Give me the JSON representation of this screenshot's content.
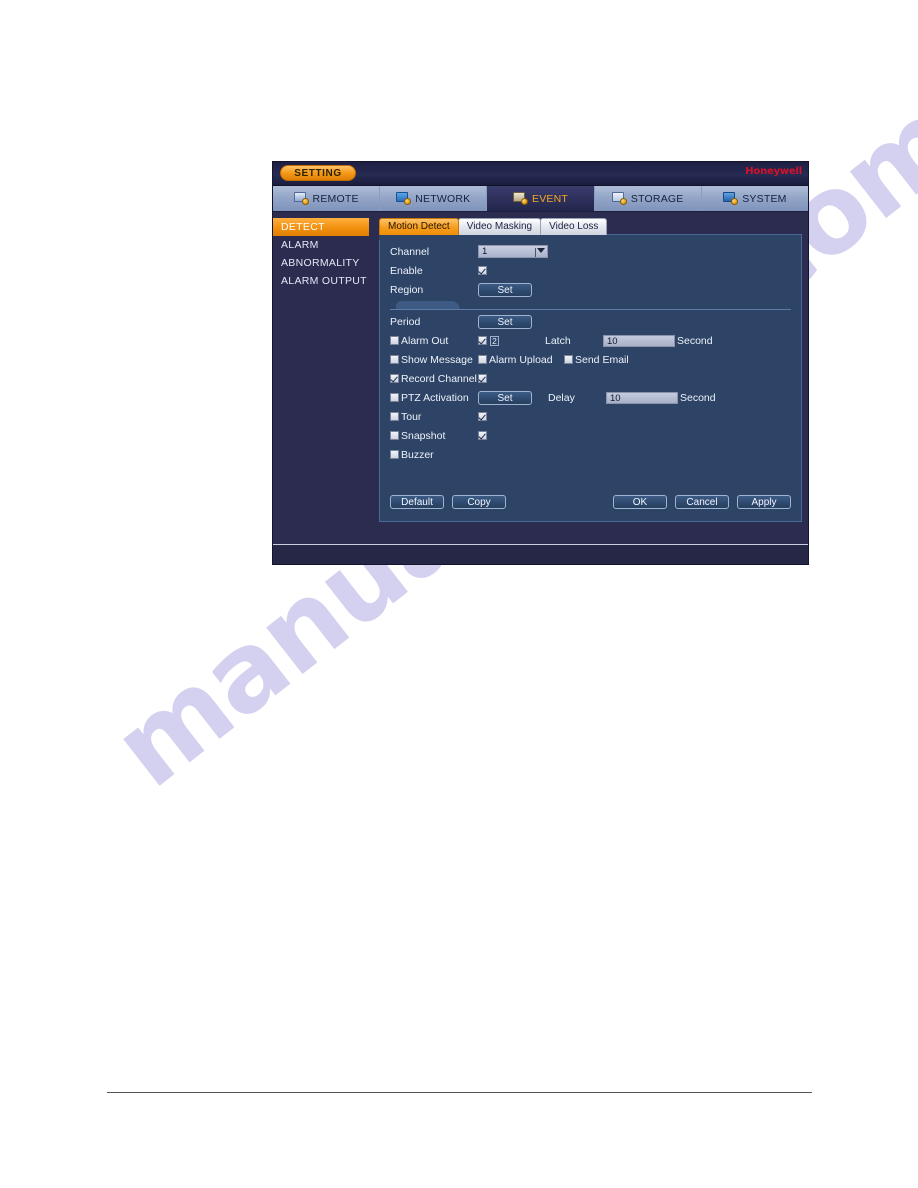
{
  "page": {
    "watermark": "manualshive.com"
  },
  "window": {
    "titlebar": {
      "setting_badge": "SETTING",
      "brand": "Honeywell"
    },
    "nav_tabs": [
      {
        "label": "REMOTE",
        "icon": "remote-icon",
        "active": false
      },
      {
        "label": "NETWORK",
        "icon": "network-icon",
        "active": false
      },
      {
        "label": "EVENT",
        "icon": "event-icon",
        "active": true
      },
      {
        "label": "STORAGE",
        "icon": "storage-icon",
        "active": false
      },
      {
        "label": "SYSTEM",
        "icon": "system-icon",
        "active": false
      }
    ],
    "side_menu": [
      {
        "label": "DETECT",
        "active": true
      },
      {
        "label": "ALARM",
        "active": false
      },
      {
        "label": "ABNORMALITY",
        "active": false
      },
      {
        "label": "ALARM OUTPUT",
        "active": false
      }
    ],
    "sub_tabs": [
      {
        "label": "Motion Detect",
        "active": true
      },
      {
        "label": "Video Masking",
        "active": false
      },
      {
        "label": "Video Loss",
        "active": false
      }
    ],
    "form": {
      "channel": {
        "label": "Channel",
        "value": "1"
      },
      "enable": {
        "label": "Enable",
        "checked": true
      },
      "region": {
        "label": "Region",
        "button": "Set"
      },
      "period": {
        "label": "Period",
        "button": "Set"
      },
      "alarm_out": {
        "label": "Alarm Out",
        "checked": false,
        "channel_checked": true,
        "channel_number": "2"
      },
      "latch": {
        "label": "Latch",
        "value": "10",
        "unit": "Second"
      },
      "show_message": {
        "label": "Show Message",
        "checked": false
      },
      "alarm_upload": {
        "label": "Alarm Upload",
        "checked": false
      },
      "send_email": {
        "label": "Send Email",
        "checked": false
      },
      "record_channel": {
        "label": "Record Channel",
        "checked": true,
        "channel_checked": true
      },
      "ptz_activation": {
        "label": "PTZ Activation",
        "checked": false,
        "button": "Set"
      },
      "delay": {
        "label": "Delay",
        "value": "10",
        "unit": "Second"
      },
      "tour": {
        "label": "Tour",
        "checked": false,
        "channel_checked": true
      },
      "snapshot": {
        "label": "Snapshot",
        "checked": false,
        "channel_checked": true
      },
      "buzzer": {
        "label": "Buzzer",
        "checked": false
      }
    },
    "buttons": {
      "default": "Default",
      "copy": "Copy",
      "ok": "OK",
      "cancel": "Cancel",
      "apply": "Apply"
    },
    "colors": {
      "accent_orange": "#f2900f",
      "brand_red": "#d8112a",
      "panel_blue": "#2e4466",
      "window_navy": "#2b2c50"
    }
  }
}
